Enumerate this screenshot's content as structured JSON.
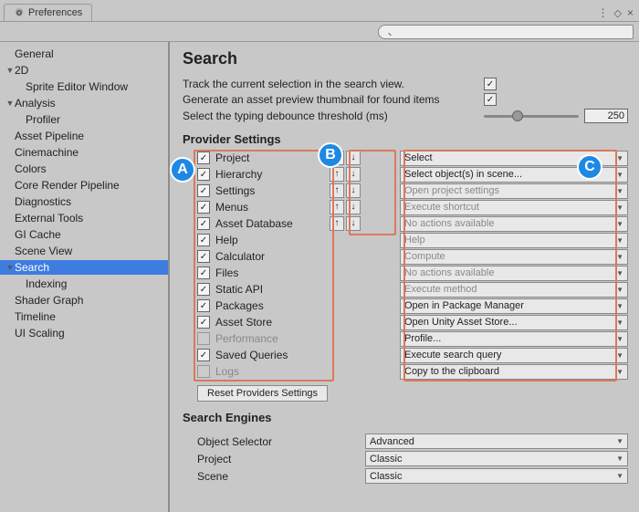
{
  "window": {
    "title": "Preferences"
  },
  "search_field": {
    "placeholder": ""
  },
  "sidebar": {
    "items": [
      {
        "label": "General",
        "indent": 1,
        "arrow": ""
      },
      {
        "label": "2D",
        "indent": 0,
        "arrow": "down"
      },
      {
        "label": "Sprite Editor Window",
        "indent": 2,
        "arrow": ""
      },
      {
        "label": "Analysis",
        "indent": 0,
        "arrow": "down"
      },
      {
        "label": "Profiler",
        "indent": 2,
        "arrow": ""
      },
      {
        "label": "Asset Pipeline",
        "indent": 1,
        "arrow": ""
      },
      {
        "label": "Cinemachine",
        "indent": 1,
        "arrow": ""
      },
      {
        "label": "Colors",
        "indent": 1,
        "arrow": ""
      },
      {
        "label": "Core Render Pipeline",
        "indent": 1,
        "arrow": ""
      },
      {
        "label": "Diagnostics",
        "indent": 1,
        "arrow": ""
      },
      {
        "label": "External Tools",
        "indent": 1,
        "arrow": ""
      },
      {
        "label": "GI Cache",
        "indent": 1,
        "arrow": ""
      },
      {
        "label": "Scene View",
        "indent": 1,
        "arrow": ""
      },
      {
        "label": "Search",
        "indent": 0,
        "arrow": "down",
        "selected": true
      },
      {
        "label": "Indexing",
        "indent": 2,
        "arrow": ""
      },
      {
        "label": "Shader Graph",
        "indent": 1,
        "arrow": ""
      },
      {
        "label": "Timeline",
        "indent": 1,
        "arrow": ""
      },
      {
        "label": "UI Scaling",
        "indent": 1,
        "arrow": ""
      }
    ]
  },
  "main": {
    "title": "Search",
    "options": {
      "track_label": "Track the current selection in the search view.",
      "track_checked": true,
      "thumb_label": "Generate an asset preview thumbnail for found items",
      "thumb_checked": true,
      "debounce_label": "Select the typing debounce threshold (ms)",
      "debounce_value": "250"
    },
    "provider_title": "Provider Settings",
    "providers": [
      {
        "name": "Project",
        "checked": true,
        "arrows": true,
        "action": "Select",
        "dim": false
      },
      {
        "name": "Hierarchy",
        "checked": true,
        "arrows": true,
        "action": "Select object(s) in scene...",
        "dim": false
      },
      {
        "name": "Settings",
        "checked": true,
        "arrows": true,
        "action": "Open project settings",
        "dim": true
      },
      {
        "name": "Menus",
        "checked": true,
        "arrows": true,
        "action": "Execute shortcut",
        "dim": true
      },
      {
        "name": "Asset Database",
        "checked": true,
        "arrows": true,
        "action": "No actions available",
        "dim": true
      },
      {
        "name": "Help",
        "checked": true,
        "arrows": false,
        "action": "Help",
        "dim": true
      },
      {
        "name": "Calculator",
        "checked": true,
        "arrows": false,
        "action": "Compute",
        "dim": true
      },
      {
        "name": "Files",
        "checked": true,
        "arrows": false,
        "action": "No actions available",
        "dim": true
      },
      {
        "name": "Static API",
        "checked": true,
        "arrows": false,
        "action": "Execute method",
        "dim": true
      },
      {
        "name": "Packages",
        "checked": true,
        "arrows": false,
        "action": "Open in Package Manager",
        "dim": false
      },
      {
        "name": "Asset Store",
        "checked": true,
        "arrows": false,
        "action": "Open Unity Asset Store...",
        "dim": false
      },
      {
        "name": "Performance",
        "checked": false,
        "arrows": false,
        "action": "Profile...",
        "dim": false,
        "disabled": true
      },
      {
        "name": "Saved Queries",
        "checked": true,
        "arrows": false,
        "action": "Execute search query",
        "dim": false
      },
      {
        "name": "Logs",
        "checked": false,
        "arrows": false,
        "action": "Copy to the clipboard",
        "dim": false,
        "disabled": true
      }
    ],
    "reset_label": "Reset Providers Settings",
    "engines_title": "Search Engines",
    "engines": [
      {
        "label": "Object Selector",
        "value": "Advanced"
      },
      {
        "label": "Project",
        "value": "Classic"
      },
      {
        "label": "Scene",
        "value": "Classic"
      }
    ]
  },
  "badges": {
    "a": "A",
    "b": "B",
    "c": "C"
  }
}
